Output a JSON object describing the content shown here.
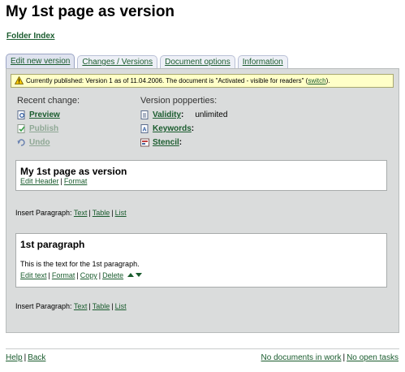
{
  "page": {
    "title": "My 1st page as version",
    "folder_index": "Folder Index"
  },
  "tabs": [
    {
      "label": "Edit new version",
      "active": true
    },
    {
      "label": "Changes / Versions",
      "active": false
    },
    {
      "label": "Document options",
      "active": false
    },
    {
      "label": "Information",
      "active": false
    }
  ],
  "notice": {
    "prefix": "Currently published: Version 1 as of 11.04.2006.    The document is \"Activated - visible for readers\" (",
    "link": "switch",
    "suffix": ")."
  },
  "recent_change": {
    "heading": "Recent change:",
    "items": [
      {
        "label": "Preview",
        "icon": "preview-icon",
        "enabled": true
      },
      {
        "label": "Publish",
        "icon": "publish-icon",
        "enabled": false
      },
      {
        "label": "Undo",
        "icon": "undo-icon",
        "enabled": false
      }
    ]
  },
  "version_properties": {
    "heading": "Version popperties:",
    "validity_label": "Validity",
    "validity_value": "unlimited",
    "keywords_label": "Keywords",
    "stencil_label": "Stencil"
  },
  "header_box": {
    "title": "My 1st page as version",
    "edit_header": "Edit Header",
    "format": "Format"
  },
  "insert_paragraph": {
    "label": "Insert Paragraph:",
    "text": "Text",
    "table": "Table",
    "list": "List"
  },
  "paragraph_box": {
    "title": "1st paragraph",
    "body": "This is the text for the 1st paragraph.",
    "edit_text": "Edit text",
    "format": "Format",
    "copy": "Copy",
    "delete": "Delete"
  },
  "footer": {
    "help": "Help",
    "back": "Back",
    "no_documents": "No documents in work",
    "no_tasks": "No open tasks"
  },
  "colors": {
    "link": "#1a5c2e",
    "panel_bg": "#dadcdc",
    "notice_bg": "#ffffc8"
  }
}
